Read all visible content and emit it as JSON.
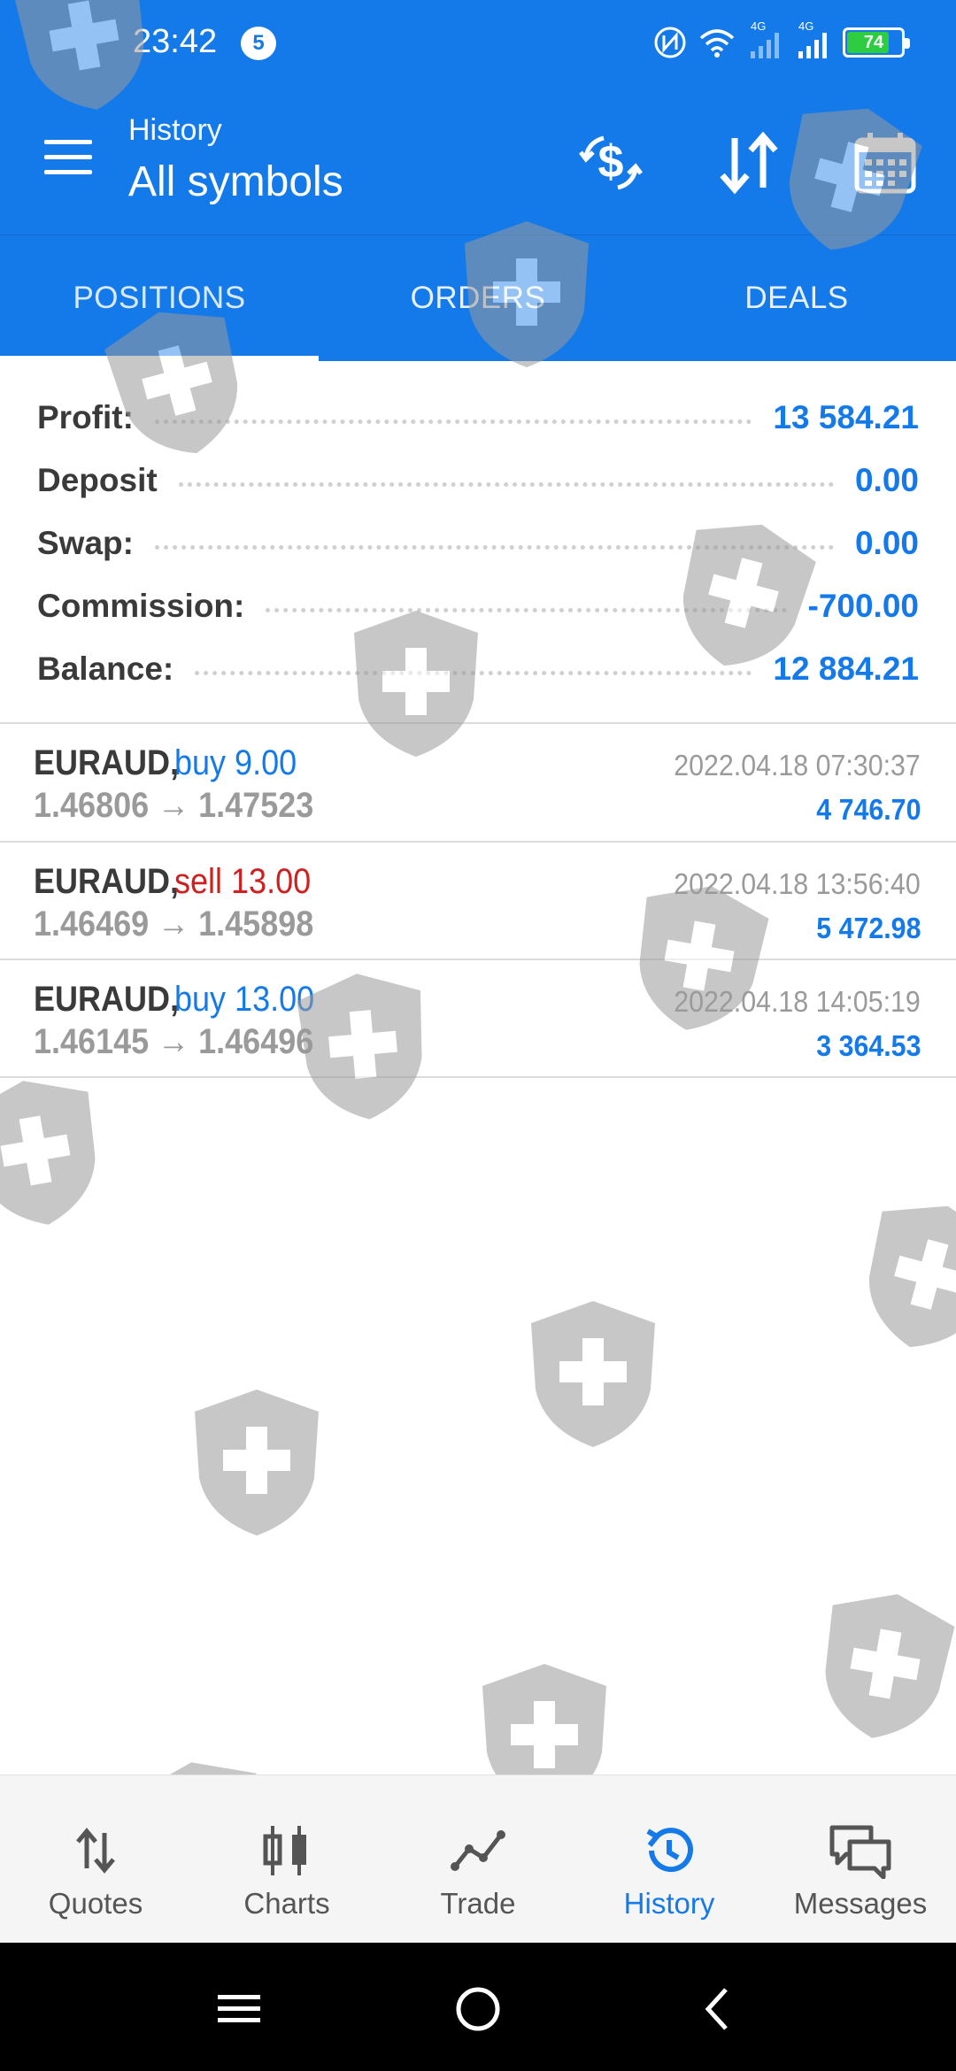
{
  "status_bar": {
    "time": "23:42",
    "notification_count": "5",
    "network_1": "4G",
    "network_2": "4G",
    "battery_level": "74",
    "battery_fraction": 0.74
  },
  "header": {
    "subtitle": "History",
    "title": "All symbols",
    "icons": [
      "currency-exchange-icon",
      "sort-icon",
      "calendar-icon"
    ]
  },
  "tabs": [
    {
      "label": "POSITIONS",
      "active": true
    },
    {
      "label": "ORDERS",
      "active": false
    },
    {
      "label": "DEALS",
      "active": false
    }
  ],
  "summary": [
    {
      "label": "Profit:",
      "value": "13 584.21"
    },
    {
      "label": "Deposit",
      "value": "0.00"
    },
    {
      "label": "Swap:",
      "value": "0.00"
    },
    {
      "label": "Commission:",
      "value": "-700.00"
    },
    {
      "label": "Balance:",
      "value": "12 884.21"
    }
  ],
  "deals": [
    {
      "symbol": "EURAUD,",
      "side": "buy 9.00",
      "side_type": "buy",
      "prices": "1.46806 → 1.47523",
      "time": "2022.04.18 07:30:37",
      "profit": "4 746.70"
    },
    {
      "symbol": "EURAUD,",
      "side": "sell 13.00",
      "side_type": "sell",
      "prices": "1.46469 → 1.45898",
      "time": "2022.04.18 13:56:40",
      "profit": "5 472.98"
    },
    {
      "symbol": "EURAUD,",
      "side": "buy 13.00",
      "side_type": "buy",
      "prices": "1.46145 → 1.46496",
      "time": "2022.04.18 14:05:19",
      "profit": "3 364.53"
    }
  ],
  "bottom_nav": [
    {
      "label": "Quotes",
      "icon": "quotes-icon",
      "active": false
    },
    {
      "label": "Charts",
      "icon": "charts-icon",
      "active": false
    },
    {
      "label": "Trade",
      "icon": "trade-icon",
      "active": false
    },
    {
      "label": "History",
      "icon": "history-icon",
      "active": true
    },
    {
      "label": "Messages",
      "icon": "messages-icon",
      "active": false
    }
  ],
  "colors": {
    "accent": "#1479e9",
    "sell": "#cf1f1f",
    "muted": "#9a9a9a"
  }
}
